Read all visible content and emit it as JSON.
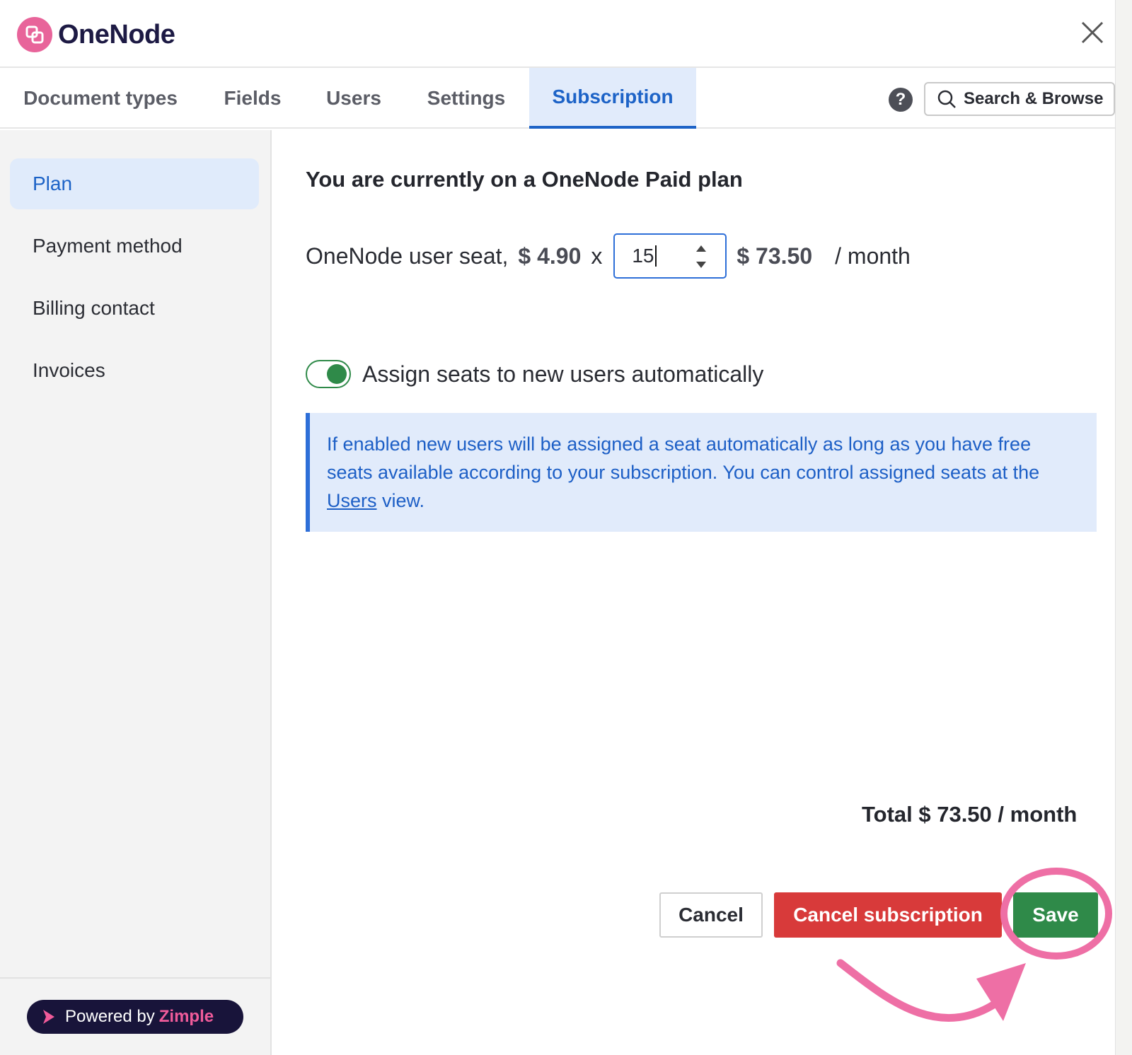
{
  "app": {
    "name": "OneNode"
  },
  "tabs": [
    {
      "label": "Document types"
    },
    {
      "label": "Fields"
    },
    {
      "label": "Users"
    },
    {
      "label": "Settings"
    },
    {
      "label": "Subscription",
      "active": true
    }
  ],
  "header": {
    "search_label": "Search & Browse",
    "help_glyph": "?"
  },
  "sidebar": {
    "items": [
      {
        "label": "Plan",
        "active": true
      },
      {
        "label": "Payment method"
      },
      {
        "label": "Billing contact"
      },
      {
        "label": "Invoices"
      }
    ],
    "powered_by": "Powered by",
    "powered_brand": "Zimple"
  },
  "main": {
    "heading": "You are currently on a OneNode Paid plan",
    "seat_label": "OneNode user seat,",
    "unit_price": "$ 4.90",
    "times": "x",
    "quantity": "15",
    "line_total": "$ 73.50",
    "per_month": "/ month",
    "auto_assign_label": "Assign seats to new users automatically",
    "auto_assign_enabled": true,
    "info_text_before": "If enabled new users will be assigned a seat automatically as long as you have free seats available according to your subscription. You can control assigned seats at the ",
    "info_link": "Users",
    "info_text_after": " view.",
    "grand_total": "Total $ 73.50 / month"
  },
  "buttons": {
    "cancel": "Cancel",
    "cancel_subscription": "Cancel subscription",
    "save": "Save"
  },
  "colors": {
    "accent": "#1d63c7",
    "brand_pink": "#e8649a",
    "danger": "#d83a3a",
    "success": "#2f8a49",
    "annotation": "#ee6fa5"
  },
  "icons": {
    "logo": "onenode-logo-icon",
    "close": "close-icon",
    "help": "help-icon",
    "search": "search-icon",
    "spinner": "spinner-icon",
    "zimple": "zimple-logo-icon"
  }
}
